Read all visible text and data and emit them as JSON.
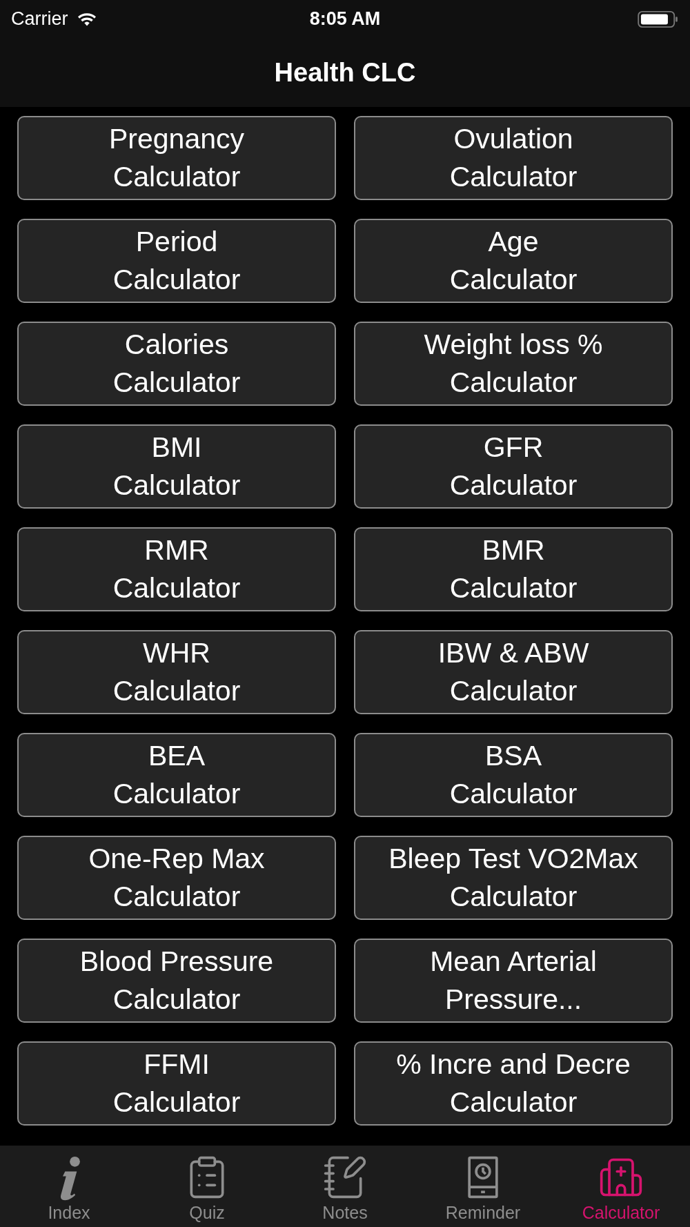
{
  "status_bar": {
    "carrier": "Carrier",
    "time": "8:05 AM"
  },
  "nav_bar": {
    "title": "Health CLC"
  },
  "calculators": [
    {
      "lines": [
        "Pregnancy",
        "Calculator"
      ]
    },
    {
      "lines": [
        "Ovulation",
        "Calculator"
      ]
    },
    {
      "lines": [
        "Period",
        "Calculator"
      ]
    },
    {
      "lines": [
        "Age",
        "Calculator"
      ]
    },
    {
      "lines": [
        "Calories",
        "Calculator"
      ]
    },
    {
      "lines": [
        "Weight loss %",
        "Calculator"
      ]
    },
    {
      "lines": [
        "BMI",
        "Calculator"
      ]
    },
    {
      "lines": [
        "GFR",
        "Calculator"
      ]
    },
    {
      "lines": [
        "RMR",
        "Calculator"
      ]
    },
    {
      "lines": [
        "BMR",
        "Calculator"
      ]
    },
    {
      "lines": [
        "WHR",
        "Calculator"
      ]
    },
    {
      "lines": [
        "IBW & ABW",
        "Calculator"
      ]
    },
    {
      "lines": [
        "BEA",
        "Calculator"
      ]
    },
    {
      "lines": [
        "BSA",
        "Calculator"
      ]
    },
    {
      "lines": [
        "One-Rep Max",
        "Calculator"
      ]
    },
    {
      "lines": [
        "Bleep Test VO2Max",
        "Calculator"
      ]
    },
    {
      "lines": [
        "Blood Pressure",
        "Calculator"
      ]
    },
    {
      "lines": [
        "Mean Arterial",
        "Pressure..."
      ]
    },
    {
      "lines": [
        "FFMI",
        "Calculator"
      ]
    },
    {
      "lines": [
        "% Incre and Decre",
        "Calculator"
      ]
    }
  ],
  "tab_bar": [
    {
      "kind": "index",
      "label": "Index",
      "selected": false
    },
    {
      "kind": "quiz",
      "label": "Quiz",
      "selected": false
    },
    {
      "kind": "notes",
      "label": "Notes",
      "selected": false
    },
    {
      "kind": "reminder",
      "label": "Reminder",
      "selected": false
    },
    {
      "kind": "calculator",
      "label": "Calculator",
      "selected": true
    }
  ]
}
